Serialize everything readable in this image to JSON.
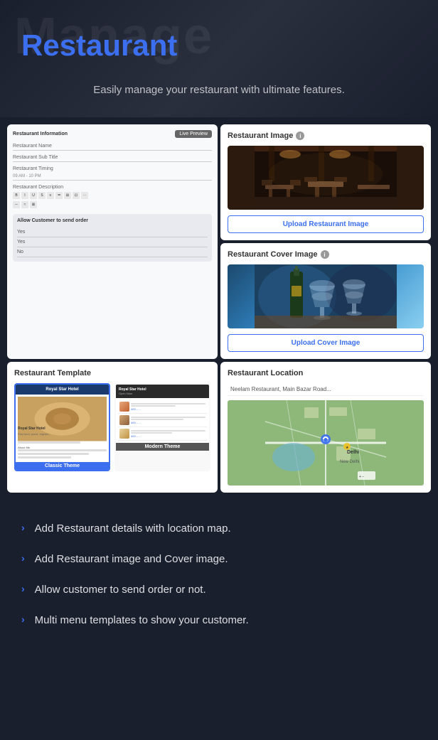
{
  "header": {
    "bg_text": "Manage",
    "title": "Restaurant",
    "subtitle": "Easily manage your restaurant with ultimate features."
  },
  "cards": {
    "restaurant_info": {
      "panel_title": "Restaurant Information",
      "live_preview": "Live Preview",
      "fields": [
        {
          "label": "Restaurant Name"
        },
        {
          "label": "Restaurant Sub Title"
        },
        {
          "label": "Restaurant Timing",
          "value": "09 AM - 10 PM"
        },
        {
          "label": "Restaurant Description"
        }
      ],
      "customer_order_title": "Allow Customer to send order",
      "order_options": [
        "Yes",
        "Yes",
        "No"
      ]
    },
    "restaurant_image": {
      "title": "Restaurant Image",
      "upload_button": "Upload Restaurant Image"
    },
    "cover_image": {
      "title": "Restaurant Cover Image",
      "upload_button": "Upload Cover Image"
    },
    "template": {
      "title": "Restaurant Template",
      "themes": [
        {
          "name": "Classic Theme",
          "active": true
        },
        {
          "name": "Modern Theme",
          "active": false
        }
      ]
    },
    "location": {
      "title": "Restaurant Location",
      "address": "Neelam Restaurant, Main Bazar Road..."
    }
  },
  "features": [
    "Add Restaurant details with location map.",
    "Add Restaurant image and Cover image.",
    "Allow customer to send order or not.",
    "Multi menu templates to show your customer."
  ],
  "colors": {
    "accent": "#3b6ff0",
    "bg": "#1a1f2e",
    "card_bg": "#ffffff"
  }
}
